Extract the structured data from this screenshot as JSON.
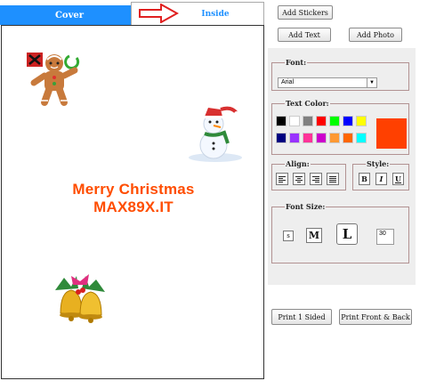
{
  "tabs": {
    "cover": "Cover",
    "inside": "Inside",
    "active": "inside"
  },
  "card": {
    "line1": "Merry Christmas",
    "line2": "MAX89X.IT"
  },
  "toolbar": {
    "add_stickers": "Add Stickers",
    "add_text": "Add Text",
    "add_photo": "Add Photo"
  },
  "font": {
    "legend": "Font:",
    "selected": "Arial"
  },
  "text_color": {
    "legend": "Text Color:",
    "selected_color": "#ff4000",
    "swatches": [
      "#000000",
      "#ffffff",
      "#808080",
      "#ff0000",
      "#00ff00",
      "#0000ff",
      "#ffff00",
      "#000080",
      "#9933ff",
      "#ff3399",
      "#cc00cc",
      "#ff9933",
      "#ff6600",
      "#00ffff"
    ]
  },
  "align": {
    "legend": "Align:"
  },
  "style": {
    "legend": "Style:",
    "bold": "B",
    "italic": "I",
    "underline": "U"
  },
  "font_size": {
    "legend": "Font Size:",
    "small": "s",
    "medium": "M",
    "large": "L",
    "value": "30"
  },
  "print": {
    "one_sided": "Print 1 Sided",
    "front_back": "Print Front & Back"
  }
}
